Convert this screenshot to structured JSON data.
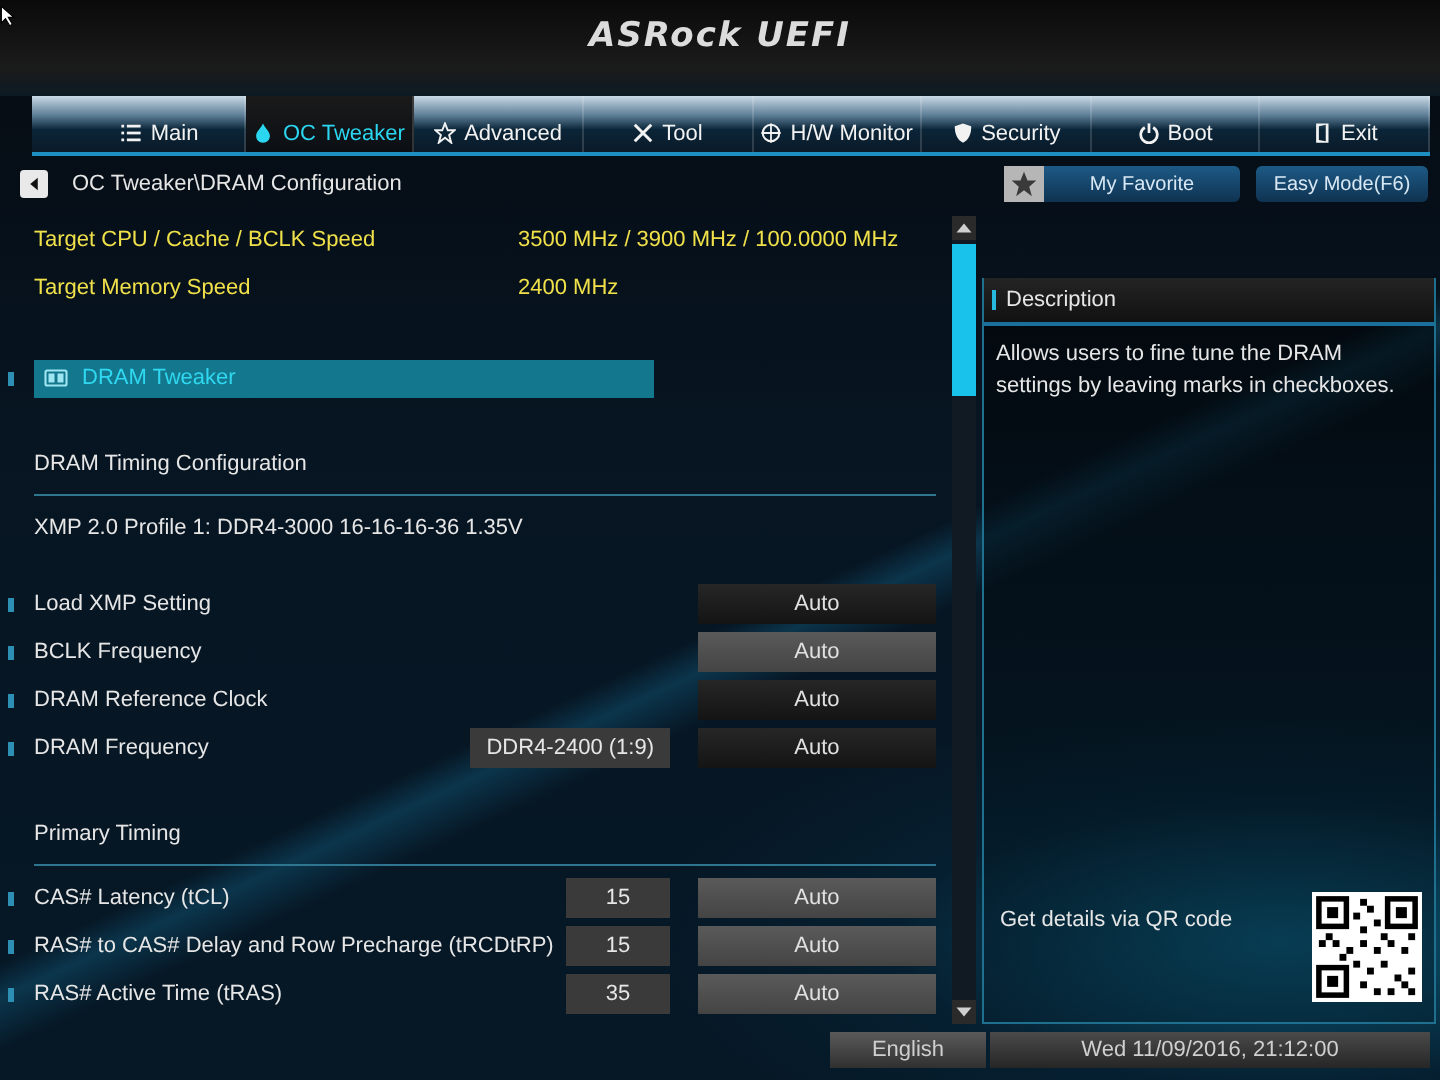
{
  "logo": "ASRock UEFI",
  "tabs": [
    {
      "label": "Main",
      "selected": false
    },
    {
      "label": "OC Tweaker",
      "selected": true
    },
    {
      "label": "Advanced",
      "selected": false
    },
    {
      "label": "Tool",
      "selected": false
    },
    {
      "label": "H/W Monitor",
      "selected": false
    },
    {
      "label": "Security",
      "selected": false
    },
    {
      "label": "Boot",
      "selected": false
    },
    {
      "label": "Exit",
      "selected": false
    }
  ],
  "breadcrumb": "OC Tweaker\\DRAM Configuration",
  "favorite_button": "My Favorite",
  "easy_mode_button": "Easy Mode(F6)",
  "items": [
    {
      "kind": "info",
      "label": "Target CPU / Cache / BCLK Speed",
      "value": "3500 MHz / 3900 MHz / 100.0000 MHz"
    },
    {
      "kind": "info",
      "label": "Target Memory Speed",
      "value": "2400 MHz"
    },
    {
      "kind": "submenu",
      "label": "DRAM Tweaker",
      "selected": true
    },
    {
      "kind": "heading",
      "label": "DRAM Timing Configuration"
    },
    {
      "kind": "text",
      "label": "XMP 2.0 Profile 1: DDR4-3000 16-16-16-36 1.35V"
    },
    {
      "kind": "setting",
      "label": "Load XMP Setting",
      "option": "Auto",
      "highlighted": false
    },
    {
      "kind": "setting",
      "label": "BCLK Frequency",
      "option": "Auto",
      "highlighted": true
    },
    {
      "kind": "setting",
      "label": "DRAM Reference Clock",
      "option": "Auto",
      "highlighted": false
    },
    {
      "kind": "setting",
      "label": "DRAM Frequency",
      "value": "DDR4-2400 (1:9)",
      "option": "Auto",
      "highlighted": false
    },
    {
      "kind": "heading",
      "label": "Primary Timing"
    },
    {
      "kind": "setting",
      "label": "CAS# Latency (tCL)",
      "value": "15",
      "option": "Auto",
      "highlighted": true
    },
    {
      "kind": "setting",
      "label": "RAS# to CAS# Delay and Row Precharge (tRCDtRP)",
      "value": "15",
      "option": "Auto",
      "highlighted": true
    },
    {
      "kind": "setting",
      "label": "RAS# Active Time (tRAS)",
      "value": "35",
      "option": "Auto",
      "highlighted": true
    }
  ],
  "description": {
    "title": "Description",
    "text": "Allows users to fine tune the DRAM settings by leaving marks in checkboxes.",
    "qr_hint": "Get details via QR code"
  },
  "status_bar": {
    "language": "English",
    "datetime": "Wed 11/09/2016, 21:12:00"
  }
}
